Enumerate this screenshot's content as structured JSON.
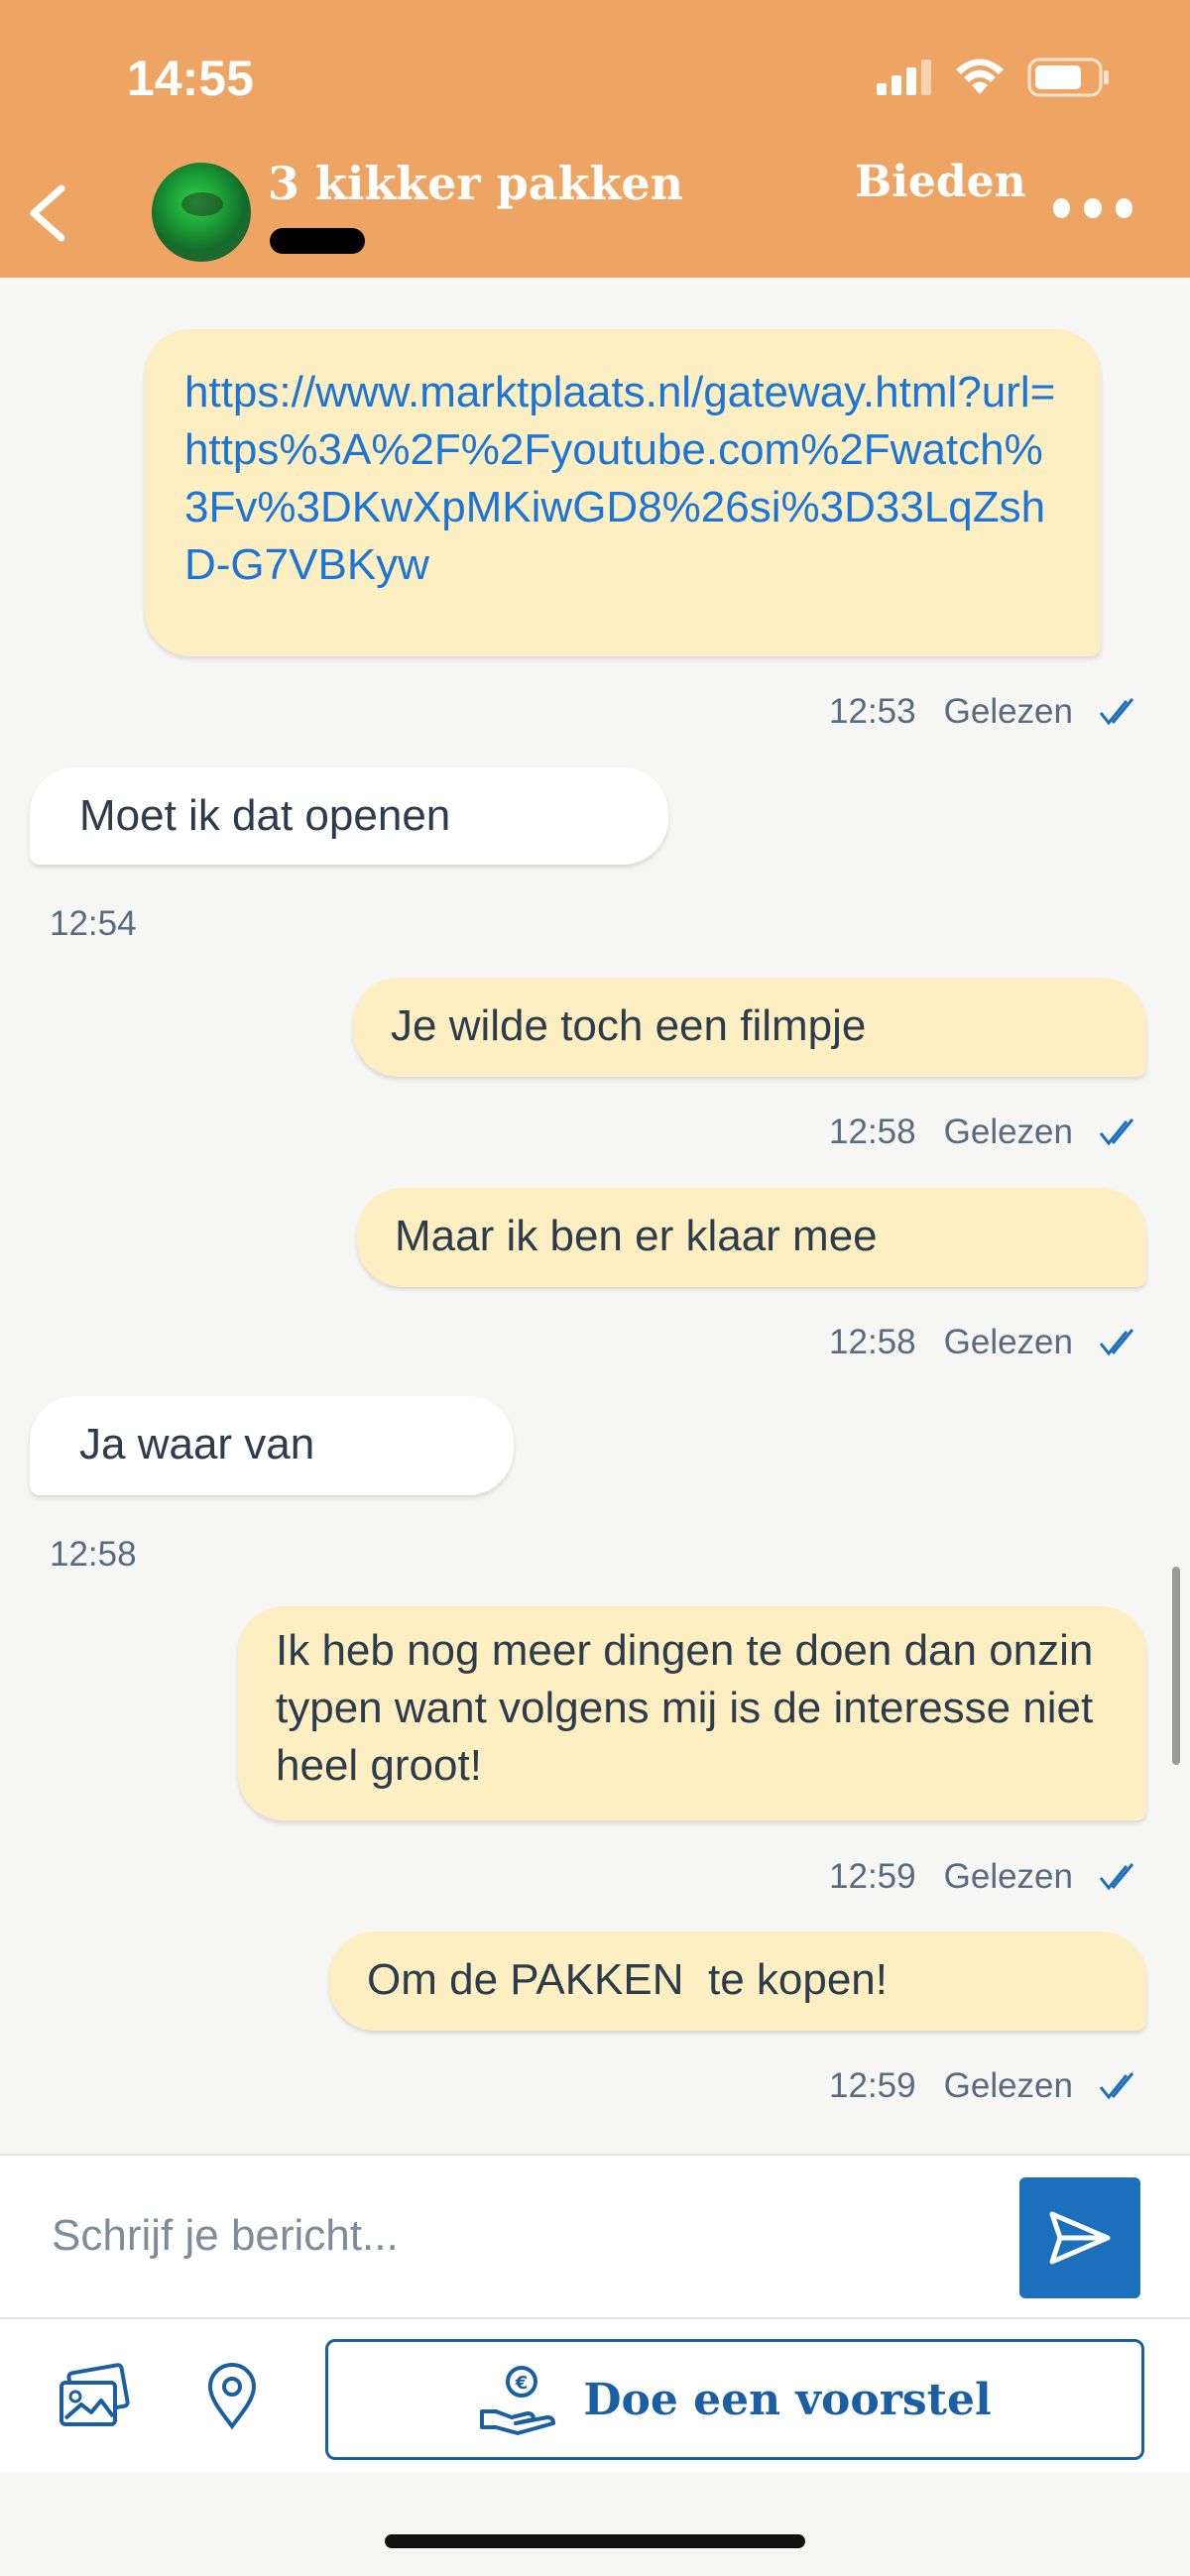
{
  "status_bar": {
    "time": "14:55"
  },
  "header": {
    "title": "3 kikker pakken",
    "offer_label": "Bieden",
    "colors": {
      "background": "#eea564",
      "text": "#ffffff"
    },
    "icons": [
      "back-arrow-icon",
      "more-icon",
      "signal-icon",
      "wifi-icon",
      "battery-icon"
    ]
  },
  "messages": [
    {
      "direction": "out",
      "text": "https://www.marktplaats.nl/gateway.html?url=https%3A%2F%2Fyoutube.com%2Fwatch%3Fv%3DKwXpMKiwGD8%26si%3D33LqZshD-G7VBKyw",
      "time": "12:53",
      "status": "Gelezen",
      "is_link": true
    },
    {
      "direction": "in",
      "text": "Moet ik dat openen",
      "time": "12:54"
    },
    {
      "direction": "out",
      "text": "Je wilde toch een filmpje",
      "time": "12:58",
      "status": "Gelezen"
    },
    {
      "direction": "out",
      "text": "Maar ik ben er klaar mee",
      "time": "12:58",
      "status": "Gelezen"
    },
    {
      "direction": "in",
      "text": "Ja waar van",
      "time": "12:58"
    },
    {
      "direction": "out",
      "text": "Ik heb nog meer dingen te doen dan onzin typen want volgens mij is de interesse niet heel groot!",
      "time": "12:59",
      "status": "Gelezen"
    },
    {
      "direction": "out",
      "text": "Om de PAKKEN  te kopen!",
      "time": "12:59",
      "status": "Gelezen"
    }
  ],
  "composer": {
    "placeholder": "Schrijf je bericht...",
    "send_icon": "send-icon"
  },
  "actions": {
    "photo_icon": "photos-icon",
    "location_icon": "location-pin-icon",
    "offer_button_label": "Doe een voorstel",
    "offer_icon": "euro-hand-icon",
    "accent": "#1b5fa3"
  },
  "colors": {
    "outgoing_bubble": "#fdefc1",
    "incoming_bubble": "#ffffff",
    "link": "#1b74d6",
    "read_check": "#1b6fbb"
  }
}
